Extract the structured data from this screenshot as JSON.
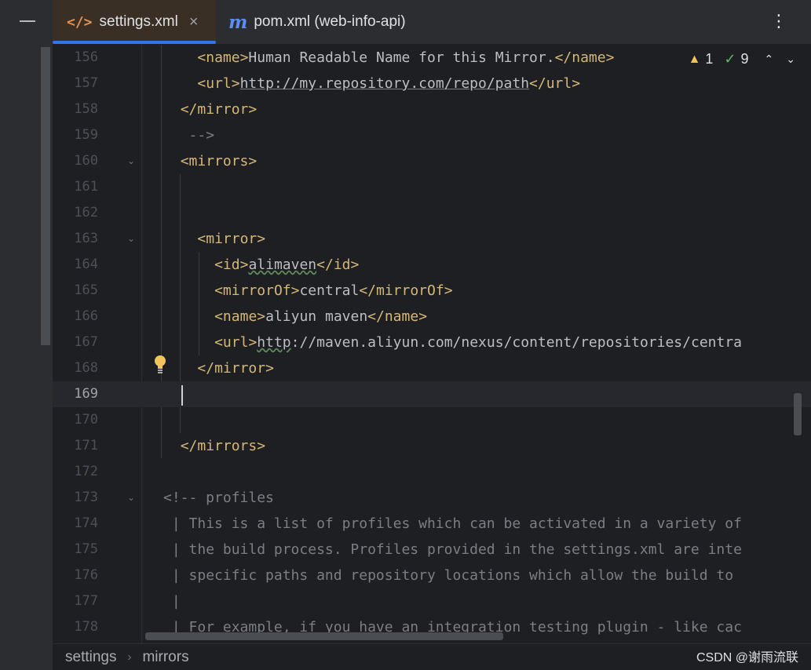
{
  "tabs": [
    {
      "label": "settings.xml",
      "active": true,
      "icon": "xml-file-icon"
    },
    {
      "label": "pom.xml (web-info-api)",
      "active": false,
      "icon": "maven-icon"
    }
  ],
  "inspections": {
    "warnings": "1",
    "ok": "9"
  },
  "lines": [
    {
      "n": "156",
      "code": [
        [
          "tag",
          "<name>"
        ],
        [
          "txt",
          "Human Readable Name for this Mirror."
        ],
        [
          "tag",
          "</name>"
        ]
      ],
      "indent": 8
    },
    {
      "n": "157",
      "code": [
        [
          "tag",
          "<url>"
        ],
        [
          "link",
          "http://my.repository.com/repo/path"
        ],
        [
          "tag",
          "</url>"
        ]
      ],
      "indent": 8
    },
    {
      "n": "158",
      "code": [
        [
          "tag",
          "</mirror>"
        ]
      ],
      "indent": 6
    },
    {
      "n": "159",
      "code": [
        [
          "cmt",
          "-->"
        ]
      ],
      "indent": 7
    },
    {
      "n": "160",
      "code": [
        [
          "tag",
          "<mirrors>"
        ]
      ],
      "indent": 6,
      "fold": true
    },
    {
      "n": "161",
      "code": [],
      "indent": 0
    },
    {
      "n": "162",
      "code": [],
      "indent": 0
    },
    {
      "n": "163",
      "code": [
        [
          "tag",
          "<mirror>"
        ]
      ],
      "indent": 8,
      "fold": true
    },
    {
      "n": "164",
      "code": [
        [
          "tag",
          "<id>"
        ],
        [
          "wavy",
          "alimaven"
        ],
        [
          "tag",
          "</id>"
        ]
      ],
      "indent": 10
    },
    {
      "n": "165",
      "code": [
        [
          "tag",
          "<mirrorOf>"
        ],
        [
          "txt",
          "central"
        ],
        [
          "tag",
          "</mirrorOf>"
        ]
      ],
      "indent": 10
    },
    {
      "n": "166",
      "code": [
        [
          "tag",
          "<name>"
        ],
        [
          "txt",
          "aliyun maven"
        ],
        [
          "tag",
          "</name>"
        ]
      ],
      "indent": 10
    },
    {
      "n": "167",
      "code": [
        [
          "tag",
          "<url>"
        ],
        [
          "wavy",
          "http"
        ],
        [
          "txt",
          "://maven.aliyun.com/nexus/content/repositories/centra"
        ]
      ],
      "indent": 10
    },
    {
      "n": "168",
      "code": [
        [
          "tag",
          "</mirror>"
        ]
      ],
      "indent": 8
    },
    {
      "n": "169",
      "code": [],
      "indent": 0,
      "current": true
    },
    {
      "n": "170",
      "code": [],
      "indent": 0
    },
    {
      "n": "171",
      "code": [
        [
          "tag",
          "</mirrors>"
        ]
      ],
      "indent": 6
    },
    {
      "n": "172",
      "code": [],
      "indent": 0
    },
    {
      "n": "173",
      "code": [
        [
          "cmt",
          "<!-- profiles"
        ]
      ],
      "indent": 4,
      "fold": true
    },
    {
      "n": "174",
      "code": [
        [
          "cmt",
          "| This is a list of profiles which can be activated in a variety of"
        ]
      ],
      "indent": 5
    },
    {
      "n": "175",
      "code": [
        [
          "cmt",
          "| the build process. Profiles provided in the settings.xml are inte"
        ]
      ],
      "indent": 5
    },
    {
      "n": "176",
      "code": [
        [
          "cmt",
          "| specific paths and repository locations which allow the build to"
        ]
      ],
      "indent": 5
    },
    {
      "n": "177",
      "code": [
        [
          "cmt",
          "|"
        ]
      ],
      "indent": 5
    },
    {
      "n": "178",
      "code": [
        [
          "cmt",
          "| For example, if you have an integration testing plugin - like cac"
        ]
      ],
      "indent": 5
    }
  ],
  "breadcrumb": [
    "settings",
    "mirrors"
  ],
  "watermark": "CSDN @谢雨流联"
}
